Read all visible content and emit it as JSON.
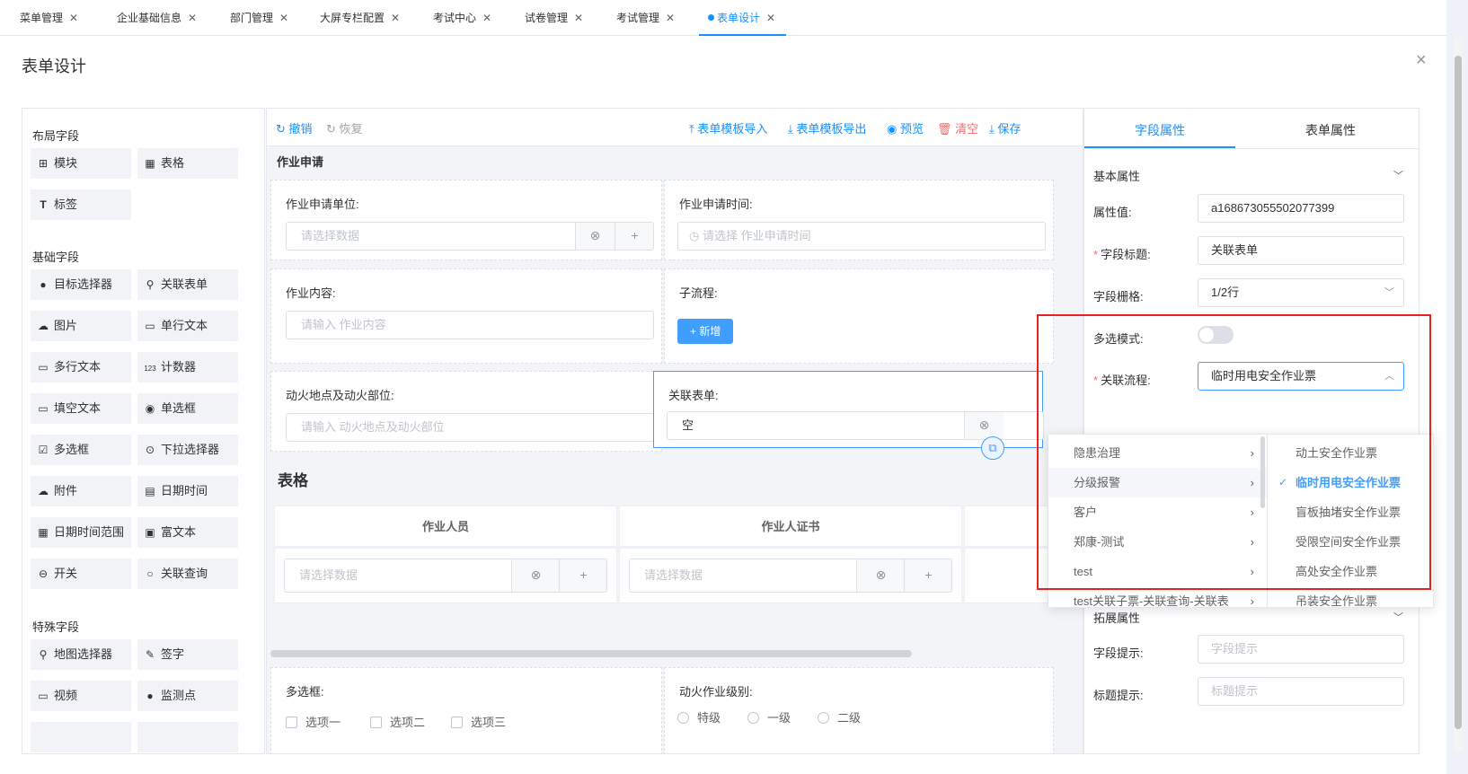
{
  "tabs": [
    {
      "label": "菜单管理",
      "active": false
    },
    {
      "label": "企业基础信息",
      "active": false
    },
    {
      "label": "部门管理",
      "active": false
    },
    {
      "label": "大屏专栏配置",
      "active": false
    },
    {
      "label": "考试中心",
      "active": false
    },
    {
      "label": "试卷管理",
      "active": false
    },
    {
      "label": "考试管理",
      "active": false
    },
    {
      "label": "表单设计",
      "active": true
    }
  ],
  "dialog": {
    "title": "表单设计",
    "close": "×"
  },
  "palette": {
    "layout_title": "布局字段",
    "layout_items": [
      {
        "label": "模块",
        "icon": "grid-icon",
        "glyph": "⊞"
      },
      {
        "label": "表格",
        "icon": "table-icon",
        "glyph": "▦"
      },
      {
        "label": "标签",
        "icon": "text-icon",
        "glyph": "T"
      }
    ],
    "basic_title": "基础字段",
    "basic_items": [
      {
        "label": "目标选择器",
        "icon": "user-icon",
        "glyph": "●"
      },
      {
        "label": "关联表单",
        "icon": "link-icon",
        "glyph": "⚲"
      },
      {
        "label": "图片",
        "icon": "cloud-icon",
        "glyph": "☁"
      },
      {
        "label": "单行文本",
        "icon": "input-icon",
        "glyph": "▭"
      },
      {
        "label": "多行文本",
        "icon": "textarea-icon",
        "glyph": "▭"
      },
      {
        "label": "计数器",
        "icon": "counter-icon",
        "glyph": "123"
      },
      {
        "label": "填空文本",
        "icon": "fill-icon",
        "glyph": "▭"
      },
      {
        "label": "单选框",
        "icon": "radio-icon",
        "glyph": "◉"
      },
      {
        "label": "多选框",
        "icon": "checkbox-icon",
        "glyph": "☑"
      },
      {
        "label": "下拉选择器",
        "icon": "select-icon",
        "glyph": "⊙"
      },
      {
        "label": "附件",
        "icon": "upload-icon",
        "glyph": "☁"
      },
      {
        "label": "日期时间",
        "icon": "date-icon",
        "glyph": "▤"
      },
      {
        "label": "日期时间范围",
        "icon": "daterange-icon",
        "glyph": "▦"
      },
      {
        "label": "富文本",
        "icon": "richtext-icon",
        "glyph": "▣"
      },
      {
        "label": "开关",
        "icon": "switch-icon",
        "glyph": "⊖"
      },
      {
        "label": "关联查询",
        "icon": "search-icon",
        "glyph": "○"
      }
    ],
    "special_title": "特殊字段",
    "special_items": [
      {
        "label": "地图选择器",
        "icon": "location-icon",
        "glyph": "⚲"
      },
      {
        "label": "签字",
        "icon": "sign-icon",
        "glyph": "✎"
      },
      {
        "label": "视频",
        "icon": "video-icon",
        "glyph": "▭"
      },
      {
        "label": "监测点",
        "icon": "monitor-point-icon",
        "glyph": "●"
      }
    ]
  },
  "toolbar": {
    "undo": "撤销",
    "redo": "恢复",
    "import": "表单模板导入",
    "export": "表单模板导出",
    "preview": "预览",
    "clear": "清空",
    "save": "保存"
  },
  "form": {
    "section_title": "作业申请",
    "apply_unit": {
      "label": "作业申请单位:",
      "placeholder": "请选择数据"
    },
    "apply_time": {
      "label": "作业申请时间:",
      "placeholder": "请选择 作业申请时间"
    },
    "content": {
      "label": "作业内容:",
      "placeholder": "请输入 作业内容"
    },
    "subflow": {
      "label": "子流程:",
      "button": "+ 新增"
    },
    "fire_place": {
      "label": "动火地点及动火部位:",
      "placeholder": "请输入 动火地点及动火部位"
    },
    "related_form": {
      "label": "关联表单:",
      "value": "空"
    },
    "table_title": "表格",
    "table_headers": [
      "作业人员",
      "作业人证书"
    ],
    "table_placeholder": "请选择数据",
    "multi": {
      "label": "多选框:",
      "options": [
        "选项一",
        "选项二",
        "选项三"
      ]
    },
    "fire_level": {
      "label": "动火作业级别:",
      "options": [
        "特级",
        "一级",
        "二级"
      ]
    }
  },
  "props": {
    "tab_field": "字段属性",
    "tab_form": "表单属性",
    "basic_title": "基本属性",
    "attr_value": {
      "label": "属性值:",
      "value": "a168673055502077399"
    },
    "field_title": {
      "label": "字段标题:",
      "value": "关联表单"
    },
    "grid": {
      "label": "字段栅格:",
      "value": "1/2行"
    },
    "multi_mode": {
      "label": "多选模式:",
      "on": false
    },
    "related_flow": {
      "label": "关联流程:",
      "value": "临时用电安全作业票"
    },
    "ext_title": "拓展属性",
    "field_hint": {
      "label": "字段提示:",
      "placeholder": "字段提示"
    },
    "title_hint": {
      "label": "标题提示:",
      "placeholder": "标题提示"
    }
  },
  "cascader": {
    "level1": [
      {
        "label": "隐患治理",
        "highlight": false
      },
      {
        "label": "分级报警",
        "highlight": true
      },
      {
        "label": "客户",
        "highlight": false
      },
      {
        "label": "郑康-测试",
        "highlight": false
      },
      {
        "label": "test",
        "highlight": false
      },
      {
        "label": "test关联子票-关联查询-关联表",
        "highlight": false
      }
    ],
    "level2": [
      {
        "label": "动土安全作业票",
        "selected": false
      },
      {
        "label": "临时用电安全作业票",
        "selected": true
      },
      {
        "label": "盲板抽堵安全作业票",
        "selected": false
      },
      {
        "label": "受限空间安全作业票",
        "selected": false
      },
      {
        "label": "高处安全作业票",
        "selected": false
      },
      {
        "label": "吊装安全作业票",
        "selected": false
      }
    ]
  },
  "colors": {
    "accent": "#1890ff",
    "danger": "#f56c6c",
    "highlight_box": "#e82222"
  }
}
